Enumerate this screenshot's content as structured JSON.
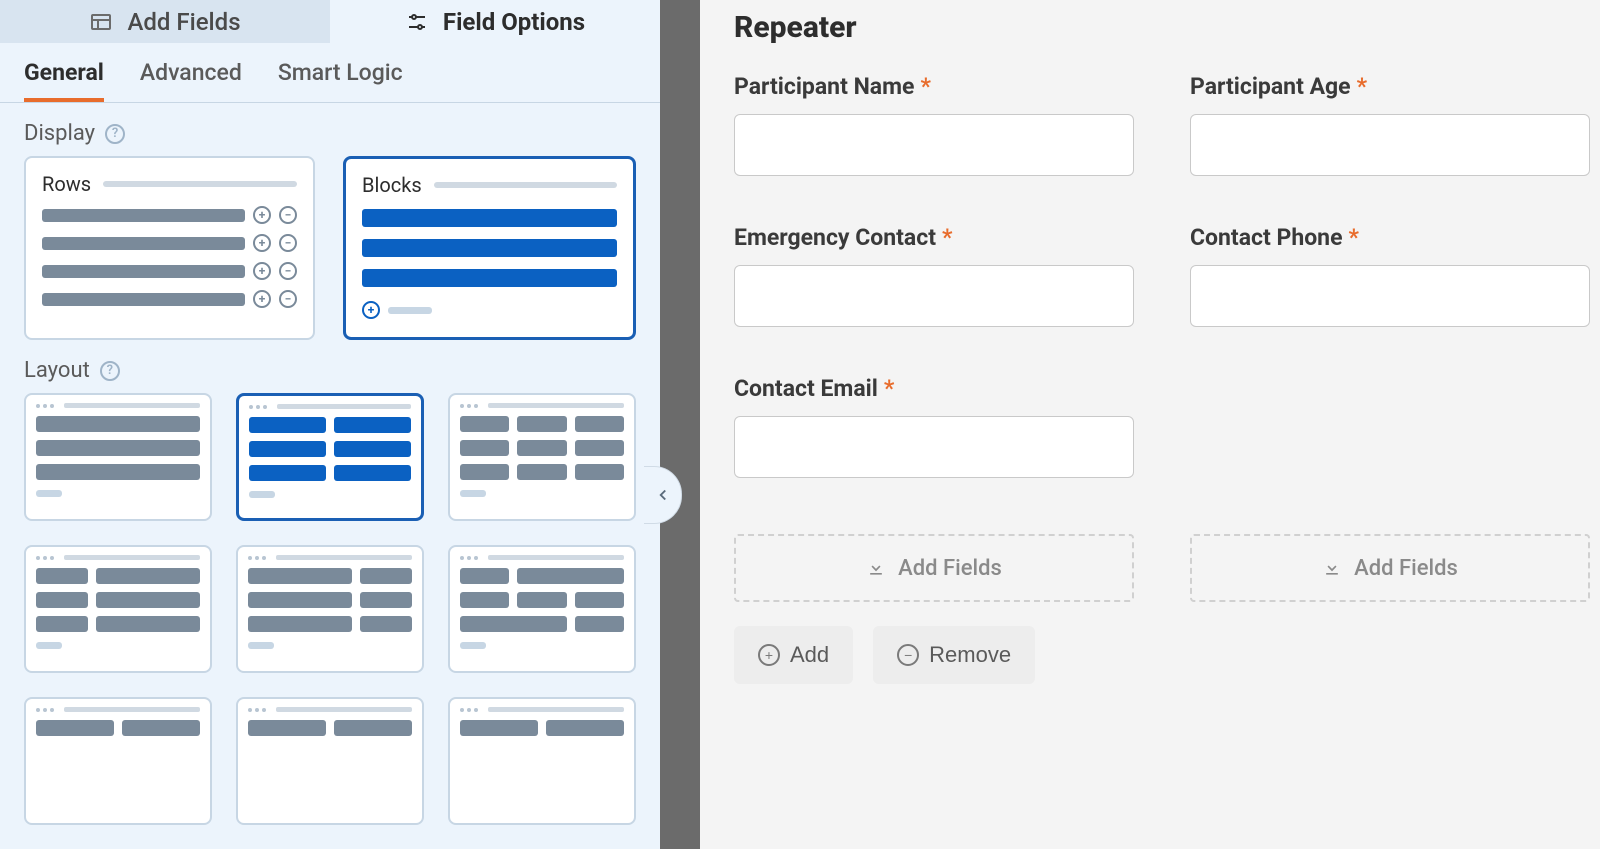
{
  "top_tabs": {
    "add_fields": "Add Fields",
    "field_options": "Field Options"
  },
  "sub_tabs": [
    "General",
    "Advanced",
    "Smart Logic"
  ],
  "active_sub_tab": 0,
  "sections": {
    "display": "Display",
    "layout": "Layout"
  },
  "display_options": {
    "rows": "Rows",
    "blocks": "Blocks",
    "selected": "blocks"
  },
  "layout": {
    "selected_index": 1
  },
  "canvas": {
    "title": "Repeater",
    "fields": [
      {
        "label": "Participant Name",
        "required": true
      },
      {
        "label": "Participant Age",
        "required": true
      },
      {
        "label": "Emergency Contact",
        "required": true
      },
      {
        "label": "Contact Phone",
        "required": true
      },
      {
        "label": "Contact Email",
        "required": true
      }
    ],
    "dropzone_label": "Add Fields",
    "actions": {
      "add": "Add",
      "remove": "Remove"
    }
  }
}
